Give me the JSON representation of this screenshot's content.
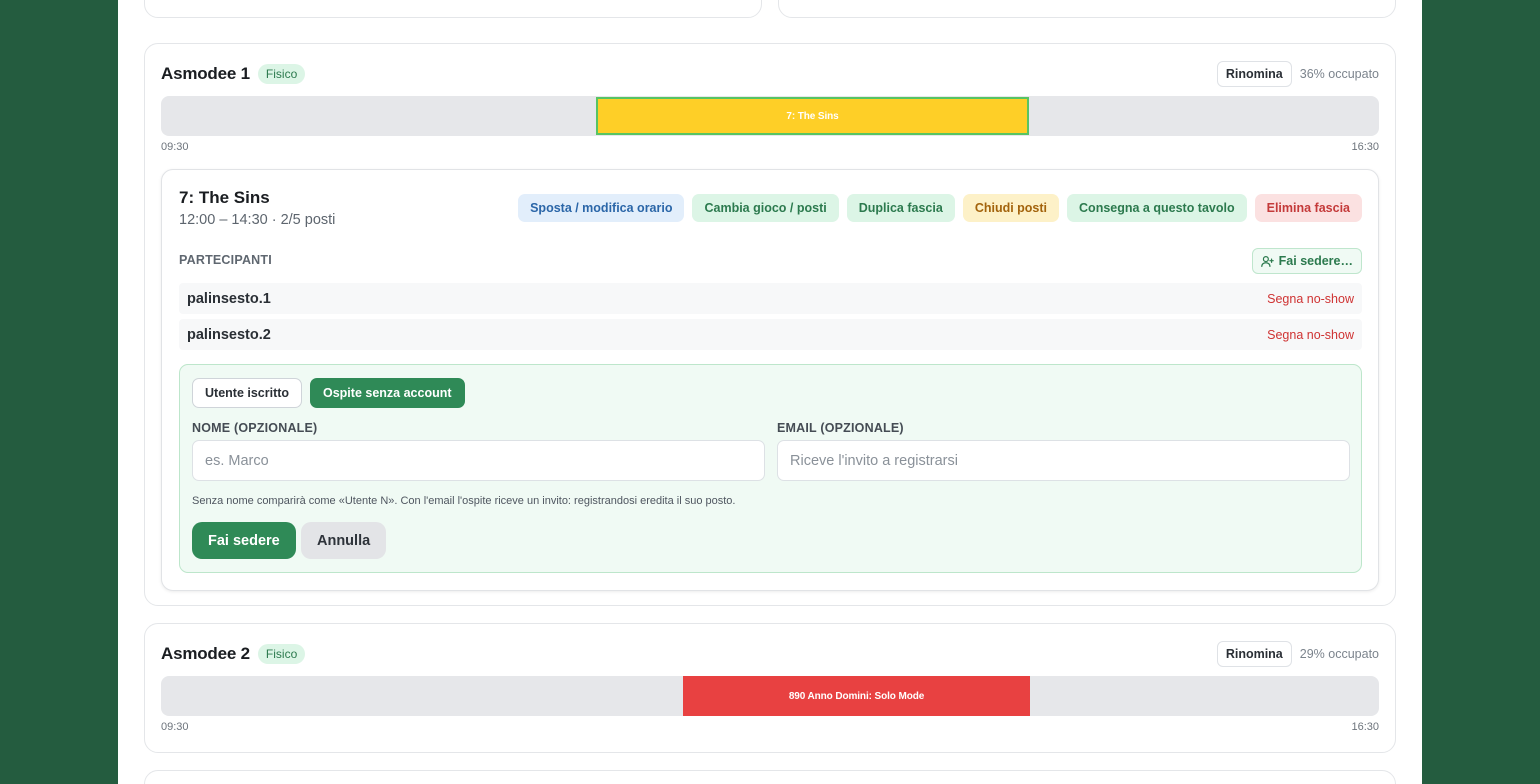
{
  "tables": [
    {
      "name": "Asmodee 1",
      "badge": "Fisico",
      "rename_label": "Rinomina",
      "occupancy": "36% occupato",
      "start_time": "09:30",
      "end_time": "16:30",
      "slot": {
        "label": "7: The Sins",
        "color": "#fecf27",
        "border": "#57c462"
      }
    },
    {
      "name": "Asmodee 2",
      "badge": "Fisico",
      "rename_label": "Rinomina",
      "occupancy": "29% occupato",
      "start_time": "09:30",
      "end_time": "16:30",
      "slot": {
        "label": "890 Anno Domini: Solo Mode",
        "color": "#e84141"
      }
    }
  ],
  "session": {
    "title": "7: The Sins",
    "subtitle": "12:00 – 14:30 · 2/5 posti",
    "actions": {
      "move": "Sposta / modifica orario",
      "change_game": "Cambia gioco / posti",
      "duplicate": "Duplica fascia",
      "close_seats": "Chiudi posti",
      "deliver": "Consegna a questo tavolo",
      "delete": "Elimina fascia"
    },
    "participants_label": "PARTECIPANTI",
    "seat_button": "Fai sedere…",
    "participants": [
      {
        "name": "palinsesto.1",
        "action": "Segna no-show"
      },
      {
        "name": "palinsesto.2",
        "action": "Segna no-show"
      }
    ]
  },
  "seat_form": {
    "tab_registered": "Utente iscritto",
    "tab_guest": "Ospite senza account",
    "name_label": "NOME (OPZIONALE)",
    "name_placeholder": "es. Marco",
    "email_label": "EMAIL (OPZIONALE)",
    "email_placeholder": "Riceve l'invito a registrarsi",
    "hint": "Senza nome comparirà come «Utente N». Con l'email l'ospite riceve un invito: registrandosi eredita il suo posto.",
    "submit": "Fai sedere",
    "cancel": "Annulla"
  },
  "colors": {
    "background": "#245c3f",
    "accent": "#2f8a57"
  }
}
